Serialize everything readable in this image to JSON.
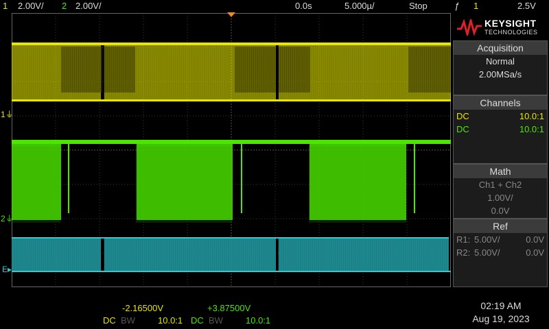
{
  "topbar": {
    "ch1_num": "1",
    "ch1_scale": "2.00V/",
    "ch2_num": "2",
    "ch2_scale": "2.00V/",
    "time_offset": "0.0s",
    "time_scale": "5.000µ/",
    "run_state": "Stop",
    "trigger_glyph": "ƒ",
    "trigger_source": "1",
    "trigger_level": "2.5V"
  },
  "logo": {
    "brand": "KEYSIGHT",
    "sub": "TECHNOLOGIES"
  },
  "acquisition": {
    "title": "Acquisition",
    "mode": "Normal",
    "rate": "2.00MSa/s"
  },
  "channels": {
    "title": "Channels",
    "rows": [
      {
        "coupling": "DC",
        "probe": "10.0:1"
      },
      {
        "coupling": "DC",
        "probe": "10.0:1"
      }
    ]
  },
  "math": {
    "title": "Math",
    "expr": "Ch1 + Ch2",
    "scale": "1.00V/",
    "offset": "0.0V"
  },
  "ref": {
    "title": "Ref",
    "rows": [
      {
        "name": "R1:",
        "scale": "5.00V/",
        "offset": "0.0V"
      },
      {
        "name": "R2:",
        "scale": "5.00V/",
        "offset": "0.0V"
      }
    ]
  },
  "markers": {
    "ch1": "1",
    "ch2": "2",
    "math": "E"
  },
  "bottom": {
    "ch1_offset": "-2.16500V",
    "ch2_offset": "+3.87500V",
    "ch1_coupling": "DC",
    "ch1_bw": "BW",
    "ch1_probe": "10.0:1",
    "ch2_coupling": "DC",
    "ch2_bw": "BW",
    "ch2_probe": "10.0:1"
  },
  "clock": {
    "time": "02:19 AM",
    "date": "Aug 19, 2023"
  },
  "colors": {
    "ch1": "#e6e600",
    "ch2": "#4ce600",
    "math": "#38c7cf",
    "grid": "#3a3a3a"
  }
}
